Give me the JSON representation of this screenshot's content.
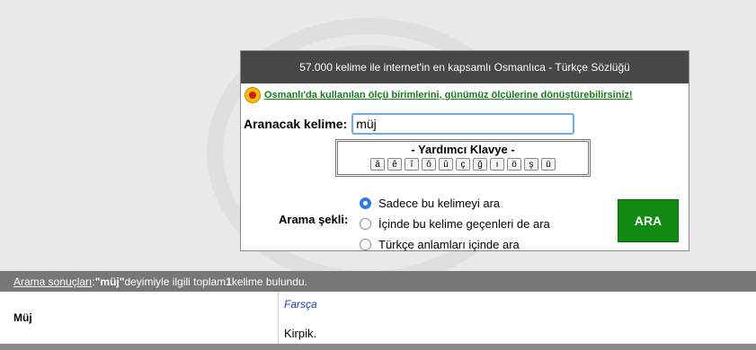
{
  "panel": {
    "header": "57.000 kelime ile internet'in en kapsamlı Osmanlıca - Türkçe Sözlüğü",
    "info_link": "Osmanlı'da kullanılan ölçü birimlerini, günümüz ölçülerine dönüştürebilirsiniz!"
  },
  "search": {
    "label": "Aranacak kelime:",
    "value": "müj"
  },
  "keyboard": {
    "title": "- Yardımcı Klavye -",
    "keys": [
      "â",
      "ê",
      "î",
      "ô",
      "û",
      "ç",
      "ğ",
      "ı",
      "ö",
      "ş",
      "ü"
    ]
  },
  "search_mode": {
    "label": "Arama şekli:",
    "options": [
      {
        "label": "Sadece bu kelimeyi ara",
        "selected": true
      },
      {
        "label": "İçinde bu kelime geçenleri de ara",
        "selected": false
      },
      {
        "label": "Türkçe anlamları içinde ara",
        "selected": false
      }
    ],
    "button": "ARA"
  },
  "results": {
    "link": "Arama sonuçları",
    "colon": ":",
    "query": "\"müj\"",
    "text_mid": " deyimiyle ilgili toplam ",
    "count": "1",
    "text_end": " kelime bulundu.",
    "rows": [
      {
        "word": "Müj",
        "language": "Farsça",
        "meaning": "Kirpik."
      }
    ]
  },
  "colors": {
    "header_bg": "#474747",
    "link_green": "#1b7a1b",
    "button_green": "#118a11",
    "results_bar": "#777777",
    "language_blue": "#1a3c9e"
  }
}
